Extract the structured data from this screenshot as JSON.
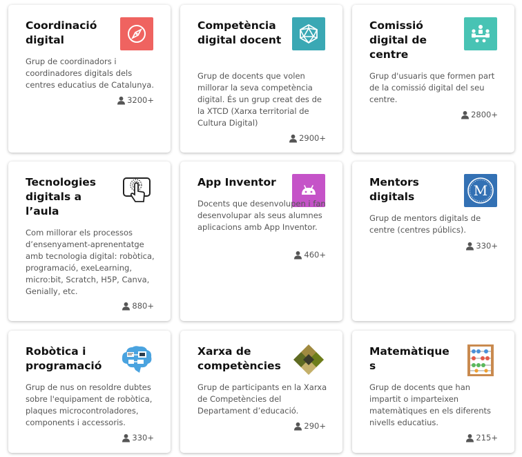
{
  "cards": [
    {
      "title": "Coordinació digital",
      "description": "Grup de coordinadors i coordinadores digitals dels centres educatius de Catalunya.",
      "members": "3200+",
      "icon": "compass-icon",
      "icon_bg": "#ef6360"
    },
    {
      "title": "Competència digital docent",
      "description": "Grup de docents que volen millorar la seva competència digital. És un grup creat des de la XTCD (Xarxa territorial de Cultura Digital)",
      "members": "2900+",
      "icon": "network-globe-icon",
      "icon_bg": "#3aa8b4"
    },
    {
      "title": "Comissió digital de centre",
      "description": "Grup d'usuaris que formen part de la comissió digital del seu centre.",
      "members": "2800+",
      "icon": "meeting-icon",
      "icon_bg": "#48c3b4"
    },
    {
      "title": "Tecnologies digitals a l’aula",
      "description": "Com millorar els processos d’ensenyament-aprenentatge amb tecnologia digital: robòtica, programació, exeLearning, micro:bit, Scratch, H5P, Canva, Genially, etc.",
      "members": "880+",
      "icon": "touch-screen-icon",
      "icon_bg": "#ffffff"
    },
    {
      "title": "App Inventor",
      "description": "Docents que desenvolupen i fan desenvolupar als seus alumnes aplicacions amb App Inventor.",
      "members": "460+",
      "icon": "android-icon",
      "icon_bg": "#c553c8"
    },
    {
      "title": "Mentors digitals",
      "description": "Grup de mentors digitals de centre (centres públics).",
      "members": "330+",
      "icon": "mentor-m-icon",
      "icon_bg": "#3371b4"
    },
    {
      "title": "Robòtica i programació",
      "description": "Grup de nus on resoldre dubtes sobre l'equipament de robòtica, plaques microcontroladores, components i accessoris.",
      "members": "330+",
      "icon": "robot-brain-icon",
      "icon_bg": "#ffffff"
    },
    {
      "title": "Xarxa de competències",
      "description": "Grup de participants en la Xarxa de Competències del Departament d’educació.",
      "members": "290+",
      "icon": "diamond-network-icon",
      "icon_bg": "#ffffff"
    },
    {
      "title": "Matemàtique s",
      "description": "Grup de docents que han impartit o imparteixen matemàtiques en els diferents nivells educatius.",
      "members": "215+",
      "icon": "abacus-icon",
      "icon_bg": "#ffffff"
    }
  ]
}
